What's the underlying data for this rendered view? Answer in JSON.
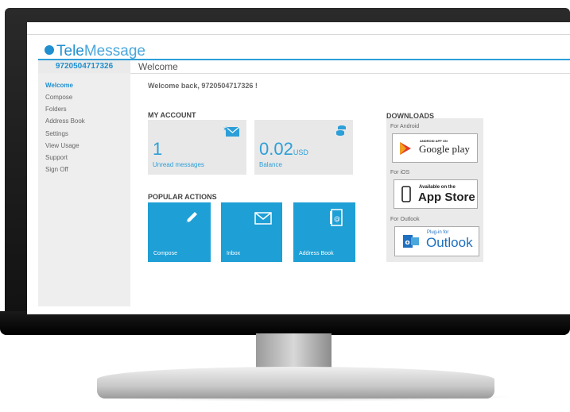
{
  "app": {
    "logo_part1": "Tele",
    "logo_part2": "Message",
    "phone": "9720504717326",
    "page_title": "Welcome"
  },
  "sidebar": {
    "items": [
      {
        "label": "Welcome",
        "active": true
      },
      {
        "label": "Compose",
        "active": false
      },
      {
        "label": "Folders",
        "active": false
      },
      {
        "label": "Address Book",
        "active": false
      },
      {
        "label": "Settings",
        "active": false
      },
      {
        "label": "View Usage",
        "active": false
      },
      {
        "label": "Support",
        "active": false
      },
      {
        "label": "Sign Off",
        "active": false
      }
    ]
  },
  "main": {
    "welcome_text": "Welcome back, 9720504717326 !",
    "my_account_heading": "MY ACCOUNT",
    "unread": {
      "value": "1",
      "label": "Unread messages"
    },
    "balance": {
      "value": "0.02",
      "unit": "USD",
      "label": "Balance"
    },
    "popular_heading": "POPULAR ACTIONS",
    "actions": [
      {
        "label": "Compose",
        "icon": "pencil-icon"
      },
      {
        "label": "Inbox",
        "icon": "envelope-icon"
      },
      {
        "label": "Address Book",
        "icon": "address-book-icon"
      }
    ]
  },
  "downloads": {
    "heading": "DOWNLOADS",
    "android": {
      "caption": "For Android",
      "small": "ANDROID APP ON",
      "big": "Google play"
    },
    "ios": {
      "caption": "For iOS",
      "small": "Available on the",
      "big": "App Store"
    },
    "outlook": {
      "caption": "For Outlook",
      "small": "Plug-in for",
      "big": "Outlook"
    }
  },
  "colors": {
    "accent": "#1e9fd5",
    "sidebar_bg": "#eeeeee",
    "panel_bg": "#e8e8e8"
  }
}
